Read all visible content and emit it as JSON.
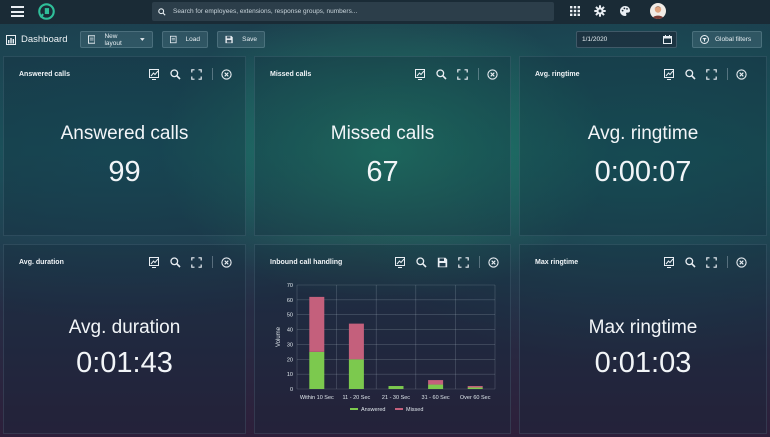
{
  "topbar": {
    "search_placeholder": "Search for employees, extensions, response groups, numbers..."
  },
  "toolbar": {
    "title": "Dashboard",
    "layout_label": "New layout",
    "load_label": "Load",
    "save_label": "Save",
    "date_value": "1/1/2020",
    "global_filters_label": "Global filters"
  },
  "cards": {
    "answered": {
      "title": "Answered calls",
      "label": "Answered calls",
      "value": "99"
    },
    "missed": {
      "title": "Missed calls",
      "label": "Missed calls",
      "value": "67"
    },
    "ringtime": {
      "title": "Avg. ringtime",
      "label": "Avg. ringtime",
      "value": "0:00:07"
    },
    "duration": {
      "title": "Avg. duration",
      "label": "Avg. duration",
      "value": "0:01:43"
    },
    "inbound": {
      "title": "Inbound call handling"
    },
    "maxring": {
      "title": "Max ringtime",
      "label": "Max ringtime",
      "value": "0:01:03"
    }
  },
  "chart_data": {
    "type": "bar",
    "stacked": true,
    "categories": [
      "Within 10 Sec",
      "11 - 20 Sec",
      "21 - 30 Sec",
      "31 - 60 Sec",
      "Over 60 Sec"
    ],
    "series": [
      {
        "name": "Answered",
        "values": [
          25,
          20,
          2,
          3,
          1
        ],
        "color": "#7cc94e"
      },
      {
        "name": "Missed",
        "values": [
          37,
          24,
          0,
          3,
          1
        ],
        "color": "#c4607c"
      }
    ],
    "xlabel": "",
    "ylabel": "Volume",
    "ylim": [
      0,
      70
    ],
    "yticks": [
      0,
      10,
      20,
      30,
      40,
      50,
      60,
      70
    ],
    "grid": true,
    "legend": "bottom"
  },
  "colors": {
    "topbar": "#1a2b36",
    "logo": "#2fbf9a",
    "answered": "#7cc94e",
    "missed": "#c4607c"
  }
}
